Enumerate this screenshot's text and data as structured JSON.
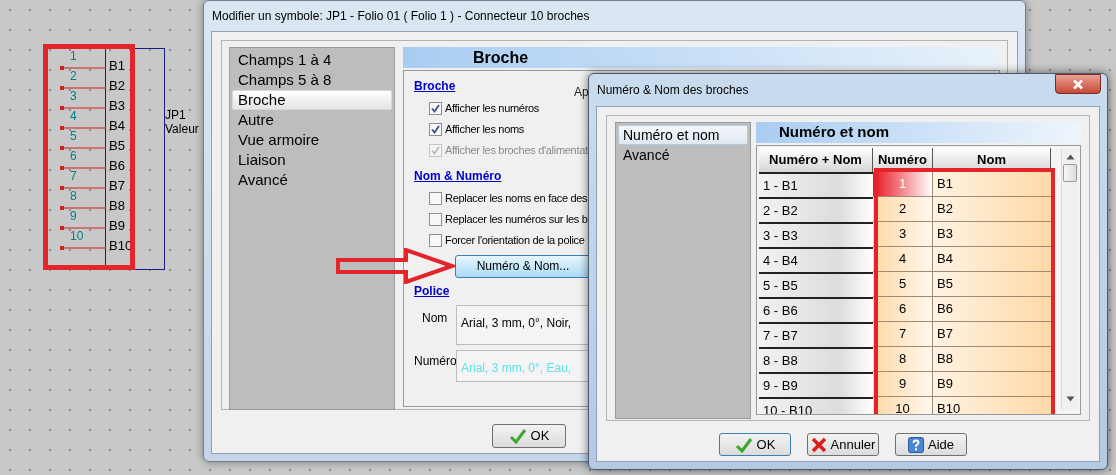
{
  "schematic": {
    "pins": [
      {
        "number": "1",
        "name": "B1"
      },
      {
        "number": "2",
        "name": "B2"
      },
      {
        "number": "3",
        "name": "B3"
      },
      {
        "number": "4",
        "name": "B4"
      },
      {
        "number": "5",
        "name": "B5"
      },
      {
        "number": "6",
        "name": "B6"
      },
      {
        "number": "7",
        "name": "B7"
      },
      {
        "number": "8",
        "name": "B8"
      },
      {
        "number": "9",
        "name": "B9"
      },
      {
        "number": "10",
        "name": "B10"
      }
    ],
    "reference": "JP1",
    "value": "Valeur"
  },
  "main_dialog": {
    "title": "Modifier un symbole: JP1 - Folio 01 ( Folio 1 ) - Connecteur 10 broches",
    "sidebar": {
      "items": [
        {
          "label": "Champs 1 à 4",
          "selected": false
        },
        {
          "label": "Champs 5 à 8",
          "selected": false
        },
        {
          "label": "Broche",
          "selected": true
        },
        {
          "label": "Autre",
          "selected": false
        },
        {
          "label": "Vue armoire",
          "selected": false
        },
        {
          "label": "Liaison",
          "selected": false
        },
        {
          "label": "Avancé",
          "selected": false
        }
      ]
    },
    "section_title": "Broche",
    "groups": [
      {
        "heading": "Broche",
        "options": [
          {
            "label": "Afficher les numéros",
            "checked": true,
            "disabled": false
          },
          {
            "label": "Afficher les noms",
            "checked": true,
            "disabled": false
          },
          {
            "label": "Afficher les broches d'alimentat",
            "checked": true,
            "disabled": true
          }
        ]
      },
      {
        "heading": "Nom & Numéro",
        "options": [
          {
            "label": "Replacer les noms en face des",
            "checked": false,
            "disabled": false
          },
          {
            "label": "Replacer les numéros sur les b",
            "checked": false,
            "disabled": false
          },
          {
            "label": "Forcer l'orientation de la police",
            "checked": false,
            "disabled": false
          }
        ]
      }
    ],
    "clipped_label": "Ap",
    "pin_button": "Numéro & Nom...",
    "font_heading": "Police",
    "font_fields": [
      {
        "label": "Nom",
        "value": "Arial, 3 mm, 0°, Noir,",
        "color": "#000000"
      },
      {
        "label": "Numéro",
        "value": "Arial, 3 mm, 0°, Eau,",
        "color": "#5ee0e8"
      }
    ],
    "buttons": [
      "OK"
    ]
  },
  "pin_dialog": {
    "title": "Numéro & Nom des broches",
    "sidebar": {
      "items": [
        {
          "label": "Numéro et nom",
          "selected": true
        },
        {
          "label": "Avancé",
          "selected": false
        }
      ]
    },
    "section_title": "Numéro et nom",
    "table": {
      "columns": [
        "Numéro + Nom",
        "Numéro",
        "Nom"
      ],
      "rows": [
        {
          "cells": [
            "1 - B1",
            "1",
            "B1"
          ],
          "selected": true
        },
        {
          "cells": [
            "2 - B2",
            "2",
            "B2"
          ],
          "selected": false
        },
        {
          "cells": [
            "3 - B3",
            "3",
            "B3"
          ],
          "selected": false
        },
        {
          "cells": [
            "4 - B4",
            "4",
            "B4"
          ],
          "selected": false
        },
        {
          "cells": [
            "5 - B5",
            "5",
            "B5"
          ],
          "selected": false
        },
        {
          "cells": [
            "6 - B6",
            "6",
            "B6"
          ],
          "selected": false
        },
        {
          "cells": [
            "7 - B7",
            "7",
            "B7"
          ],
          "selected": false
        },
        {
          "cells": [
            "8 - B8",
            "8",
            "B8"
          ],
          "selected": false
        },
        {
          "cells": [
            "9 - B9",
            "9",
            "B9"
          ],
          "selected": false
        },
        {
          "cells": [
            "10 - B10",
            "10",
            "B10"
          ],
          "selected": false
        }
      ]
    },
    "buttons": [
      {
        "label": "OK",
        "kind": "ok"
      },
      {
        "label": "Annuler",
        "kind": "cancel"
      },
      {
        "label": "Aide",
        "kind": "help"
      }
    ]
  }
}
